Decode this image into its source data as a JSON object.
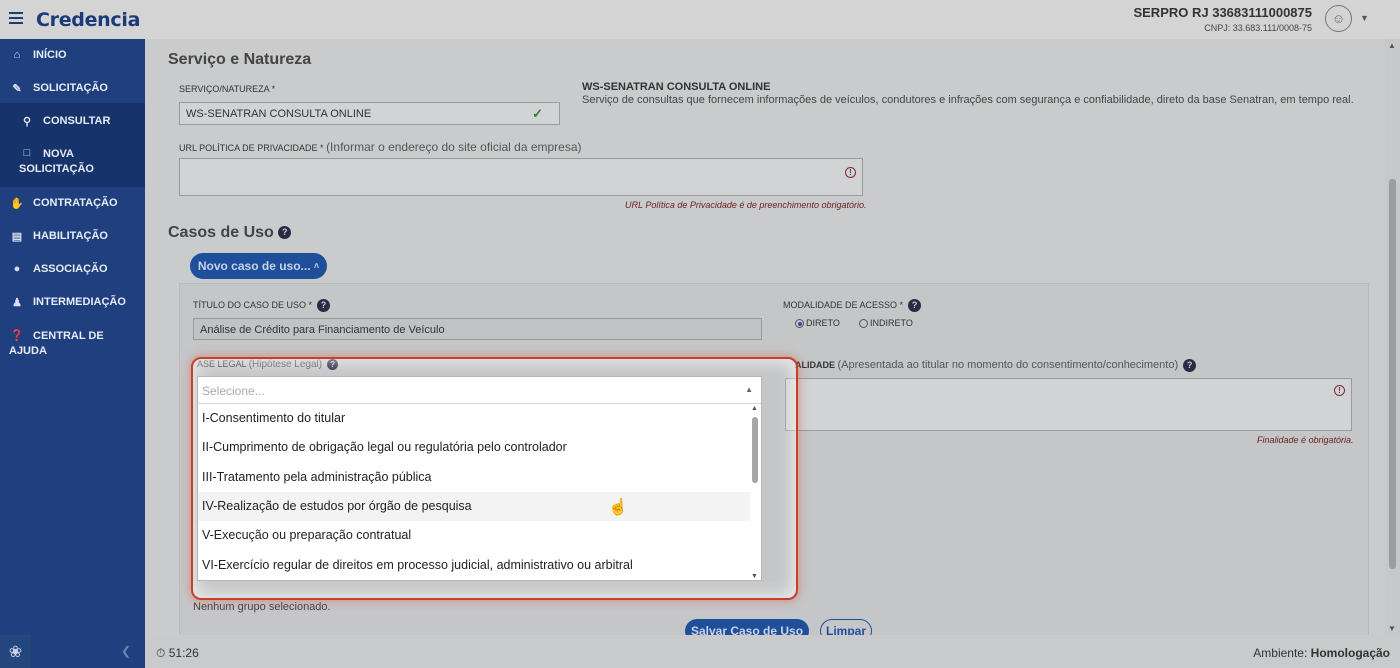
{
  "header": {
    "logo": "Credencia",
    "org_name": "SERPRO RJ 33683111000875",
    "org_cnpj": "CNPJ: 33.683.111/0008-75"
  },
  "sidebar": {
    "items": [
      {
        "label": "INÍCIO",
        "icon": "home-icon"
      },
      {
        "label": "SOLICITAÇÃO",
        "icon": "edit-icon"
      },
      {
        "label": "CONSULTAR",
        "icon": "search-icon"
      },
      {
        "label": "NOVA SOLICITAÇÃO",
        "icon": "file-icon"
      },
      {
        "label": "CONTRATAÇÃO",
        "icon": "handshake-icon"
      },
      {
        "label": "HABILITAÇÃO",
        "icon": "id-card-icon"
      },
      {
        "label": "ASSOCIAÇÃO",
        "icon": "users-icon"
      },
      {
        "label": "INTERMEDIAÇÃO",
        "icon": "person-icon"
      },
      {
        "label": "CENTRAL DE AJUDA",
        "icon": "help-icon"
      }
    ]
  },
  "servico": {
    "title": "Serviço e Natureza",
    "field_label": "SERVIÇO/NATUREZA *",
    "field_value": "WS-SENATRAN CONSULTA ONLINE",
    "desc_title": "WS-SENATRAN CONSULTA ONLINE",
    "desc_text": "Serviço de consultas que fornecem informações de veículos, condutores e infrações com segurança e confiabilidade, direto da base Senatran, em tempo real.",
    "url_label": "URL POLÍTICA DE PRIVACIDADE *",
    "url_hint": "(Informar o endereço do site oficial da empresa)",
    "url_error": "URL Política de Privacidade é de preenchimento obrigatório."
  },
  "casos": {
    "title": "Casos de Uso",
    "new_button": "Novo caso de uso...",
    "titulo_label": "TÍTULO DO CASO DE USO *",
    "titulo_value": "Análise de Crédito para Financiamento de Veículo",
    "modalidade_label": "MODALIDADE DE ACESSO *",
    "modalidade_direto": "DIRETO",
    "modalidade_indireto": "INDIRETO",
    "base_label": "ASE LEGAL",
    "base_hint": "(Hipótese Legal)",
    "finalidade_label": "ALIDADE",
    "finalidade_hint": "(Apresentada ao titular no momento do consentimento/conhecimento)",
    "finalidade_error": "Finalidade é obrigatória.",
    "nenhum_grupo": "Nenhum grupo selecionado.",
    "save_button": "Salvar Caso de Uso",
    "clear_button": "Limpar"
  },
  "dropdown": {
    "placeholder": "Selecione...",
    "options": [
      "I-Consentimento do titular",
      "II-Cumprimento de obrigação legal ou regulatória pelo controlador",
      "III-Tratamento pela administração pública",
      "IV-Realização de estudos por órgão de pesquisa",
      "V-Execução ou preparação contratual",
      "VI-Exercício regular de direitos em processo judicial, administrativo ou arbitral"
    ]
  },
  "footer": {
    "timer": "51:26",
    "ambiente_label": "Ambiente:",
    "ambiente_value": "Homologação"
  },
  "colors": {
    "sidebar": "#1f3f7e",
    "accent": "#1f4f9a",
    "highlight": "#c5412a"
  }
}
